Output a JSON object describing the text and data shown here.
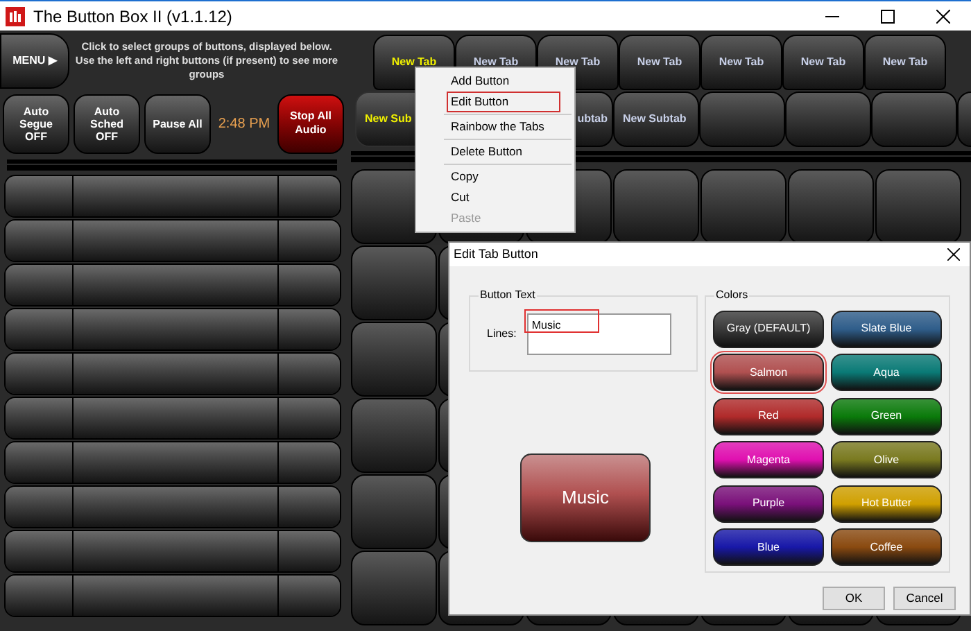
{
  "window": {
    "title": "The Button Box II (v1.1.12)"
  },
  "menu_button": {
    "label": "MENU ▶"
  },
  "instructions": "Click to select groups of buttons, displayed below. Use the left and right buttons (if present) to see more groups",
  "controls": [
    {
      "label": "Auto\nSegue\nOFF",
      "kind": "normal"
    },
    {
      "label": "Auto\nSched\nOFF",
      "kind": "normal"
    },
    {
      "label": "Pause All",
      "kind": "normal"
    },
    {
      "label": "2:48 PM",
      "kind": "clock"
    },
    {
      "label": "Stop All\nAudio",
      "kind": "alert"
    }
  ],
  "tabs": [
    {
      "label": "New Tab",
      "selected": true
    },
    {
      "label": "New Tab",
      "selected": false
    },
    {
      "label": "New Tab",
      "selected": false
    },
    {
      "label": "New Tab",
      "selected": false
    },
    {
      "label": "New Tab",
      "selected": false
    },
    {
      "label": "New Tab",
      "selected": false
    },
    {
      "label": "New Tab",
      "selected": false
    }
  ],
  "subtabs": [
    {
      "label": "New Sub",
      "selected": true
    },
    {
      "label": "ubtab",
      "selected": false
    },
    {
      "label": "New Subtab",
      "selected": false
    },
    {
      "selected": false
    },
    {
      "selected": false
    },
    {
      "selected": false
    },
    {
      "selected": false
    }
  ],
  "context_menu": {
    "items": [
      {
        "kind": "item",
        "label": "Add Button",
        "selected": false,
        "disabled": false
      },
      {
        "kind": "item",
        "label": "Edit Button",
        "selected": true,
        "disabled": false
      },
      {
        "kind": "separator"
      },
      {
        "kind": "item",
        "label": "Rainbow the Tabs",
        "selected": false,
        "disabled": false
      },
      {
        "kind": "separator"
      },
      {
        "kind": "item",
        "label": "Delete Button",
        "selected": false,
        "disabled": false
      },
      {
        "kind": "separator"
      },
      {
        "kind": "item",
        "label": "Copy",
        "selected": false,
        "disabled": false
      },
      {
        "kind": "item",
        "label": "Cut",
        "selected": false,
        "disabled": false
      },
      {
        "kind": "item",
        "label": "Paste",
        "selected": false,
        "disabled": true
      }
    ]
  },
  "dialog": {
    "title": "Edit Tab Button",
    "button_text": {
      "group_label": "Button Text",
      "lines_label": "Lines:",
      "value": "Music",
      "highlighted": true
    },
    "preview": {
      "label": "Music"
    },
    "colors": {
      "group_label": "Colors",
      "items": [
        {
          "label": "Gray (DEFAULT)",
          "color": "#3a3a3a",
          "selected": false
        },
        {
          "label": "Slate Blue",
          "color": "#2f5d8a",
          "selected": false
        },
        {
          "label": "Salmon",
          "color": "#b05050",
          "selected": true
        },
        {
          "label": "Aqua",
          "color": "#0a7a76",
          "selected": false
        },
        {
          "label": "Red",
          "color": "#b02a2a",
          "selected": false
        },
        {
          "label": "Green",
          "color": "#0a7a0a",
          "selected": false
        },
        {
          "label": "Magenta",
          "color": "#e010b0",
          "selected": false
        },
        {
          "label": "Olive",
          "color": "#7a7a20",
          "selected": false
        },
        {
          "label": "Purple",
          "color": "#7a107a",
          "selected": false
        },
        {
          "label": "Hot Butter",
          "color": "#d0a000",
          "selected": false
        },
        {
          "label": "Blue",
          "color": "#1818a8",
          "selected": false
        },
        {
          "label": "Coffee",
          "color": "#8a4a10",
          "selected": false
        }
      ]
    },
    "buttons": [
      "OK",
      "Cancel"
    ]
  }
}
